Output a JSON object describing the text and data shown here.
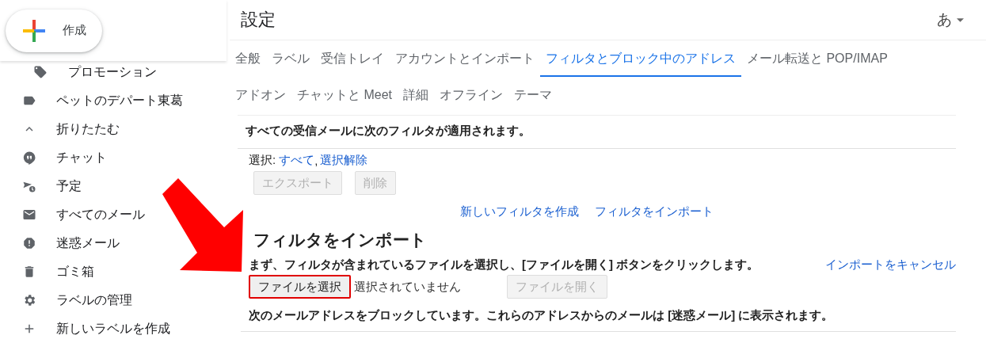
{
  "compose": {
    "label": "作成"
  },
  "sidebar": {
    "items": [
      {
        "kind": "tag",
        "label": "プロモーション",
        "indented": true
      },
      {
        "kind": "label",
        "label": "ペットのデパート東葛",
        "indented": false
      },
      {
        "kind": "collapse",
        "label": "折りたたむ",
        "indented": false
      },
      {
        "kind": "chat",
        "label": "チャット",
        "indented": false
      },
      {
        "kind": "scheduled",
        "label": "予定",
        "indented": false
      },
      {
        "kind": "mail",
        "label": "すべてのメール",
        "indented": false
      },
      {
        "kind": "spam",
        "label": "迷惑メール",
        "indented": false
      },
      {
        "kind": "trash",
        "label": "ゴミ箱",
        "indented": false
      },
      {
        "kind": "gear",
        "label": "ラベルの管理",
        "indented": false
      },
      {
        "kind": "plus",
        "label": "新しいラベルを作成",
        "indented": false
      }
    ]
  },
  "header": {
    "title": "設定",
    "input_tool": "あ"
  },
  "tabs": [
    [
      {
        "label": "全般",
        "selected": false
      },
      {
        "label": "ラベル",
        "selected": false
      },
      {
        "label": "受信トレイ",
        "selected": false
      },
      {
        "label": "アカウントとインポート",
        "selected": false
      },
      {
        "label": "フィルタとブロック中のアドレス",
        "selected": true
      },
      {
        "label": "メール転送と POP/IMAP",
        "selected": false
      }
    ],
    [
      {
        "label": "アドオン",
        "selected": false
      },
      {
        "label": "チャットと Meet",
        "selected": false
      },
      {
        "label": "詳細",
        "selected": false
      },
      {
        "label": "オフライン",
        "selected": false
      },
      {
        "label": "テーマ",
        "selected": false
      }
    ]
  ],
  "filters": {
    "intro": "すべての受信メールに次のフィルタが適用されます。",
    "select_label": "選択:",
    "select_links": [
      "すべて",
      "選択解除"
    ],
    "link_separator": ",",
    "buttons": [
      {
        "label": "エクスポート",
        "disabled": true
      },
      {
        "label": "削除",
        "disabled": true
      }
    ],
    "links": [
      "新しいフィルタを作成",
      "フィルタをインポート"
    ]
  },
  "import": {
    "heading": "フィルタをインポート",
    "instruction": "まず、フィルタが含まれているファイルを選択し、[ファイルを開く] ボタンをクリックします。",
    "cancel_link": "インポートをキャンセル",
    "choose_button": {
      "label": "ファイルを選択",
      "highlighted": true
    },
    "file_status": "選択されていません",
    "open_button": {
      "label": "ファイルを開く",
      "disabled": true
    }
  },
  "blocked": {
    "text": "次のメールアドレスをブロックしています。これらのアドレスからのメールは [迷惑メール] に表示されます。"
  }
}
